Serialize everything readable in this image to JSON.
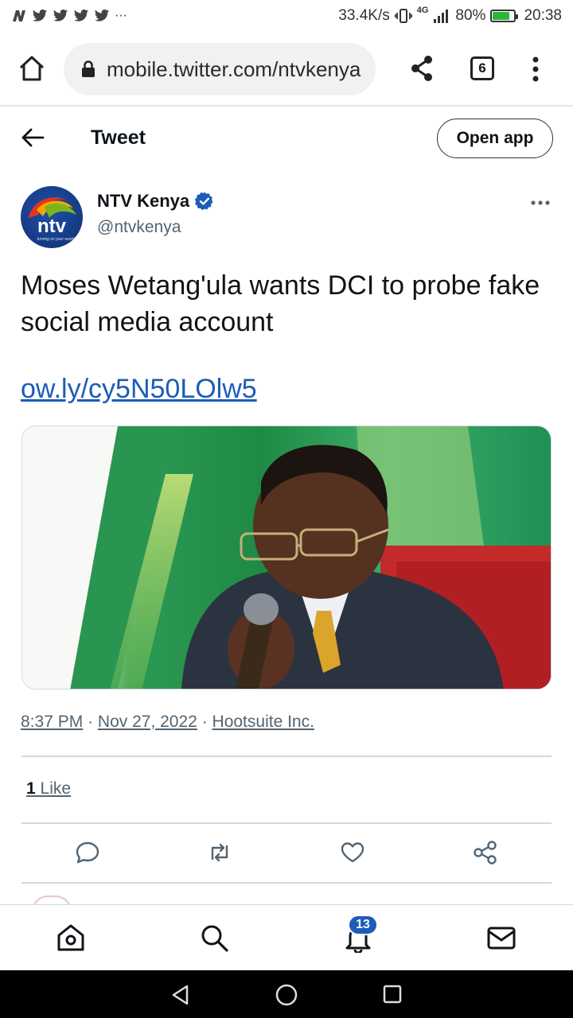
{
  "status_bar": {
    "speed": "33.4K/s",
    "network": "4G",
    "battery": "80%",
    "battery_level": 0.8,
    "time": "20:38"
  },
  "browser": {
    "url": "mobile.twitter.com/ntvkenya",
    "tab_count": "6"
  },
  "header": {
    "title": "Tweet",
    "open_app": "Open app"
  },
  "author": {
    "name": "NTV Kenya",
    "handle": "@ntvkenya",
    "avatar_text": "ntv",
    "avatar_tagline": "turning on your world",
    "verified": true
  },
  "tweet": {
    "text": "Moses Wetang'ula wants DCI to probe fake social media account",
    "link": "ow.ly/cy5N50LOlw5",
    "time": "8:37 PM",
    "date": "Nov 27, 2022",
    "separator": "·",
    "source": "Hootsuite Inc.",
    "like_count": "1",
    "like_label": "Like"
  },
  "actions": [
    "reply-icon",
    "retweet-icon",
    "like-icon",
    "share-icon"
  ],
  "bottom_nav": {
    "items": [
      "home-icon",
      "search-icon",
      "notifications-icon",
      "messages-icon"
    ],
    "notification_badge": "13"
  },
  "colors": {
    "link": "#1d5cb8",
    "verified": "#1d5cb8",
    "muted": "#536471"
  }
}
